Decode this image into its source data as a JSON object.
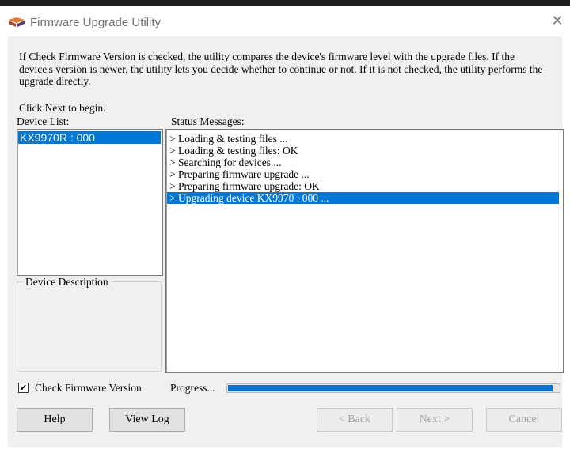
{
  "window": {
    "title": "Firmware Upgrade Utility"
  },
  "info": {
    "text": "If Check Firmware Version is checked, the utility compares the device's firmware level with the upgrade files. If the device's version is newer, the utility lets you decide whether to continue or not. If it is not checked, the utility performs the upgrade directly.",
    "begin": "Click Next to begin."
  },
  "device_list": {
    "label": "Device List:",
    "items": [
      "KX9970R : 000"
    ]
  },
  "status": {
    "label": "Status Messages:",
    "messages": [
      "> Loading & testing files ...",
      "> Loading & testing files: OK",
      "> Searching for devices ...",
      "> Preparing firmware upgrade ...",
      "> Preparing firmware upgrade: OK",
      "> Upgrading device KX9970 : 000 ..."
    ],
    "selected_index": 5
  },
  "device_description": {
    "label": "Device Description"
  },
  "check_firmware": {
    "label": "Check Firmware Version",
    "checked": true,
    "mark": "✔"
  },
  "progress": {
    "label": "Progress...",
    "value": 0.98
  },
  "buttons": {
    "help": "Help",
    "view_log": "View Log",
    "back": "< Back",
    "next": "Next >",
    "cancel": "Cancel"
  },
  "icons": {
    "app": "firmware-app-icon",
    "close": "close-icon"
  },
  "colors": {
    "selection": "#0078d7",
    "progress": "#0a74d2"
  }
}
